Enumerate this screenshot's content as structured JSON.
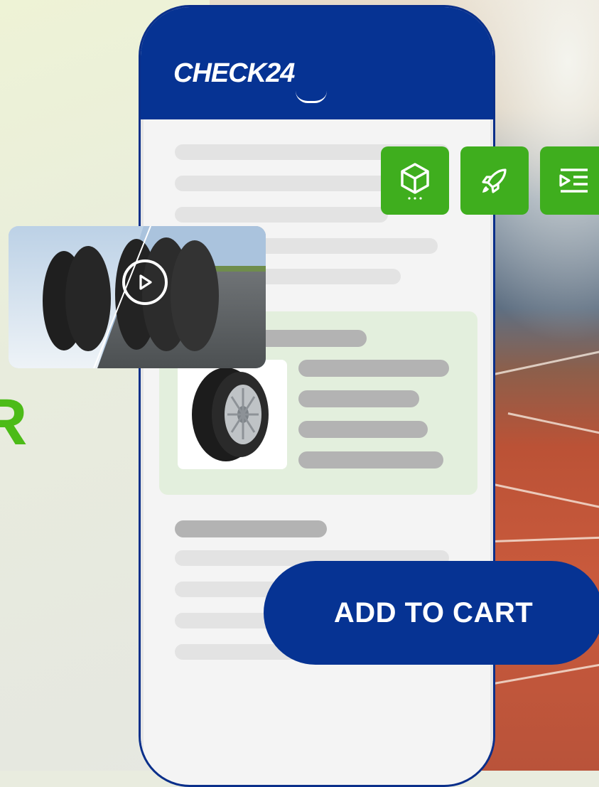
{
  "app": {
    "logo_text": "CHECK24"
  },
  "headline": {
    "partial_letter": "R"
  },
  "action_icons": [
    "package-icon",
    "rocket-icon",
    "list-icon"
  ],
  "video": {
    "play_icon": "play-icon"
  },
  "cart": {
    "label": "ADD TO CART"
  },
  "colors": {
    "brand_blue": "#063393",
    "brand_green": "#3fae1e",
    "card_green": "#e3efdd"
  }
}
